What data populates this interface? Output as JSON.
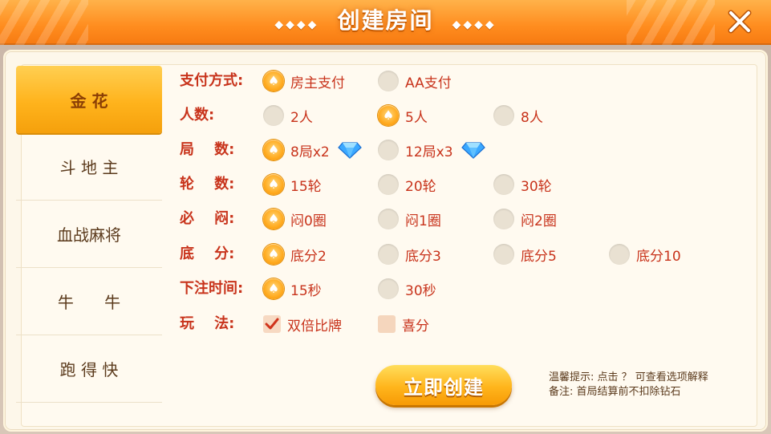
{
  "header": {
    "title": "创建房间",
    "deco_left": "◆◆◆◆",
    "deco_right": "◆◆◆◆"
  },
  "sidebar": {
    "tabs": [
      {
        "label": "金  花",
        "active": true
      },
      {
        "label": "斗 地 主",
        "active": false
      },
      {
        "label": "血战麻将",
        "active": false
      },
      {
        "label": "牛      牛",
        "active": false
      },
      {
        "label": "跑 得 快",
        "active": false
      }
    ]
  },
  "options": {
    "pay": {
      "label": "支付方式:",
      "choices": [
        "房主支付",
        "AA支付"
      ],
      "selected": 0
    },
    "players": {
      "label": "人数:",
      "choices": [
        "2人",
        "5人",
        "8人"
      ],
      "selected": 1
    },
    "rounds": {
      "label": "局    数:",
      "choices": [
        "8局x2",
        "12局x3"
      ],
      "selected": 0
    },
    "turns": {
      "label": "轮    数:",
      "choices": [
        "15轮",
        "20轮",
        "30轮"
      ],
      "selected": 0
    },
    "blind": {
      "label": "必    闷:",
      "choices": [
        "闷0圈",
        "闷1圈",
        "闷2圈"
      ],
      "selected": 0
    },
    "base": {
      "label": "底    分:",
      "choices": [
        "底分2",
        "底分3",
        "底分5",
        "底分10"
      ],
      "selected": 0
    },
    "bet_time": {
      "label": "下注时间:",
      "choices": [
        "15秒",
        "30秒"
      ],
      "selected": 0
    },
    "play": {
      "label": "玩    法:",
      "choices": [
        "双倍比牌",
        "喜分"
      ],
      "checked": [
        true,
        false
      ]
    }
  },
  "create_button": "立即创建",
  "tips": {
    "line1": "温馨提示: 点击 ？ 可查看选项解释",
    "line2": "备注: 首局结算前不扣除钻石"
  },
  "colors": {
    "accent": "#ff9a1a",
    "label": "#c8331b",
    "panel": "#fdf7ea"
  }
}
